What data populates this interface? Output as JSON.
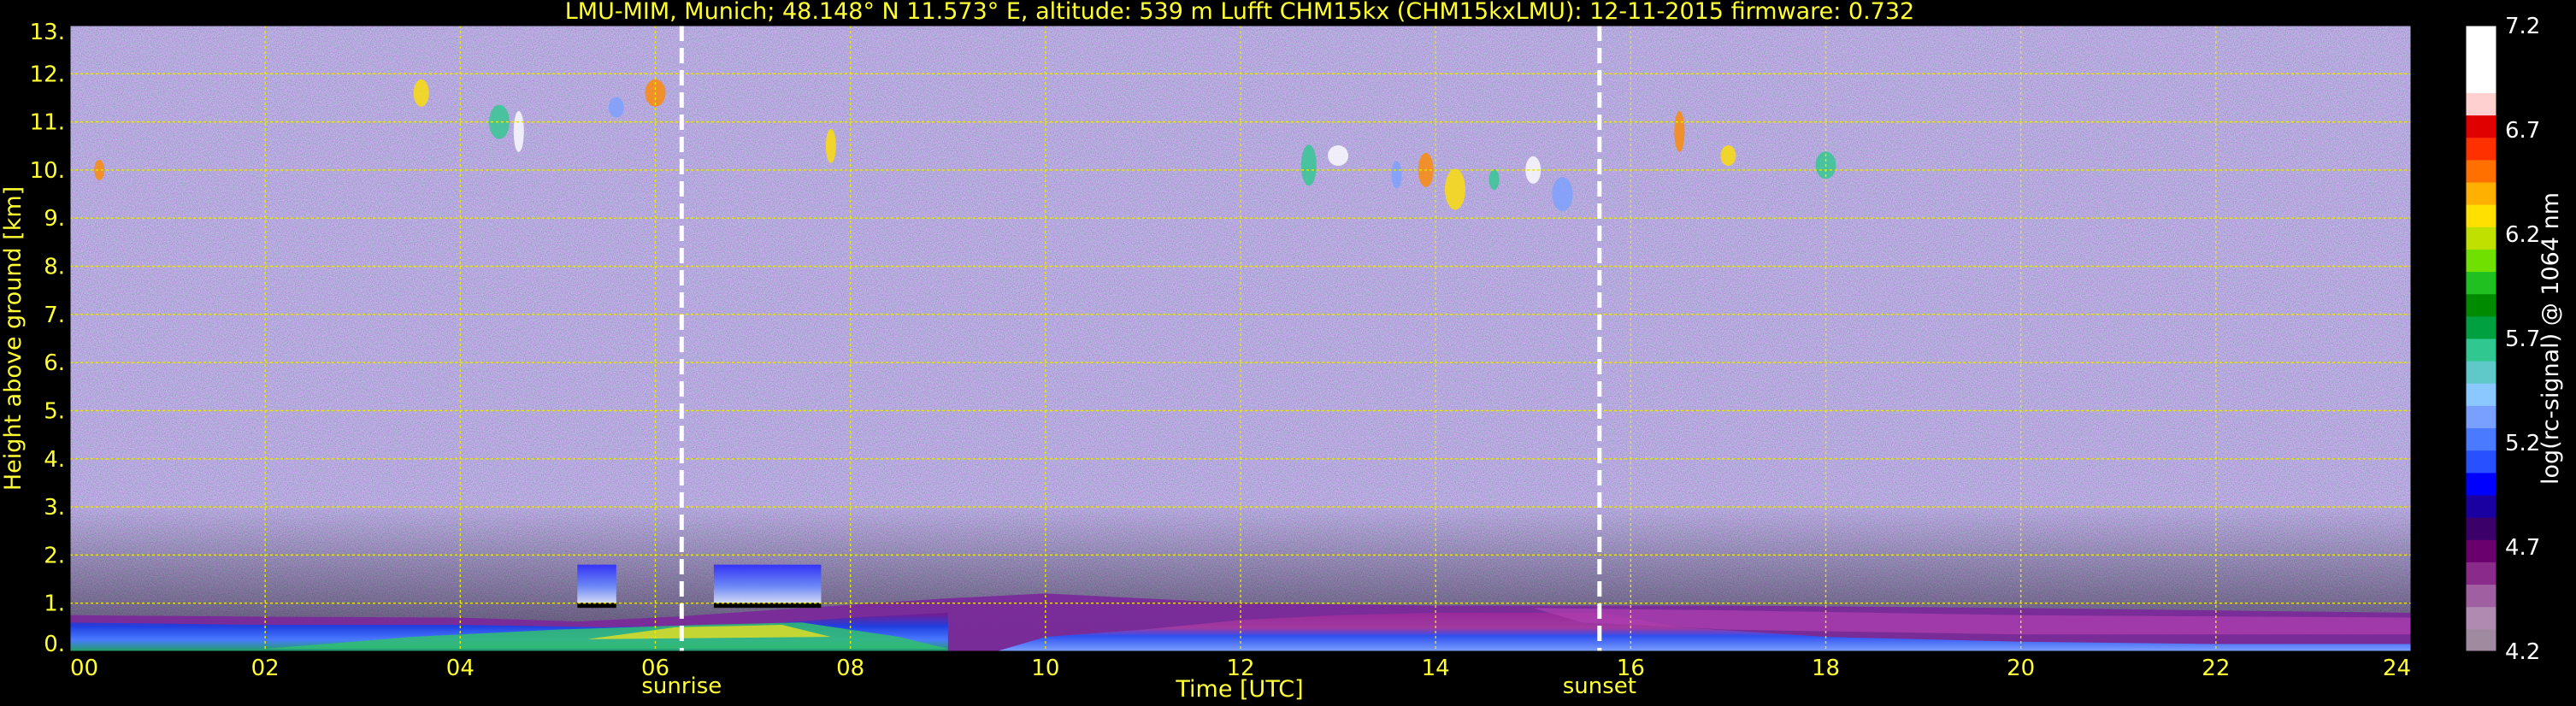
{
  "chart_data": {
    "type": "heatmap",
    "title": "LMU-MIM, Munich; 48.148° N 11.573° E, altitude: 539 m    Lufft CHM15kx (CHM15kxLMU): 12-11-2015    firmware: 0.732",
    "xlabel": "Time [UTC]",
    "ylabel": "Height above ground [km]",
    "xlim": [
      0,
      24
    ],
    "ylim": [
      0,
      13
    ],
    "x_ticks": [
      "00",
      "02",
      "04",
      "06",
      "08",
      "10",
      "12",
      "14",
      "16",
      "18",
      "20",
      "22",
      "24"
    ],
    "y_ticks": [
      "0.",
      "1.",
      "2.",
      "3.",
      "4.",
      "5.",
      "6.",
      "7.",
      "8.",
      "9.",
      "10.",
      "11.",
      "12.",
      "13."
    ],
    "grid": true,
    "markers": [
      {
        "time": 6.27,
        "label": "sunrise"
      },
      {
        "time": 15.68,
        "label": "sunset"
      }
    ],
    "colorbar": {
      "label": "log(rc-signal) @ 1064 nm",
      "range": [
        4.2,
        7.2
      ],
      "ticks": [
        "4.2",
        "4.7",
        "5.2",
        "5.7",
        "6.2",
        "6.7",
        "7.2"
      ],
      "colors": [
        "#a08aa0",
        "#b08ab0",
        "#a05fa0",
        "#8a2a8a",
        "#6a006e",
        "#3c006a",
        "#1a00a0",
        "#0000ff",
        "#2850ff",
        "#4a7aff",
        "#7aa0ff",
        "#8ac8ff",
        "#5fc8c8",
        "#30c890",
        "#00a040",
        "#008a00",
        "#20c020",
        "#70e000",
        "#c0e000",
        "#ffe000",
        "#ffb000",
        "#ff7000",
        "#ff3000",
        "#e00000",
        "#ffd0d0",
        "#ffffff",
        "#ffffff",
        "#ffffff"
      ]
    },
    "layers": [
      {
        "name": "noise background",
        "height_km": [
          1.0,
          13.0
        ],
        "time": [
          0,
          24
        ]
      },
      {
        "name": "boundary layer aerosol",
        "height_km": [
          0.0,
          0.8
        ],
        "time": [
          0,
          24
        ]
      },
      {
        "name": "low cloud patches",
        "height_km": [
          0.9,
          1.8
        ],
        "time": [
          5.2,
          7.7
        ]
      },
      {
        "name": "cirrus traces",
        "height_km": [
          9.3,
          12.0
        ],
        "time": [
          3.5,
          18.0
        ]
      }
    ],
    "colors": {
      "text": "#ffff33",
      "grid": "#e8e800",
      "background": "#000000"
    }
  }
}
